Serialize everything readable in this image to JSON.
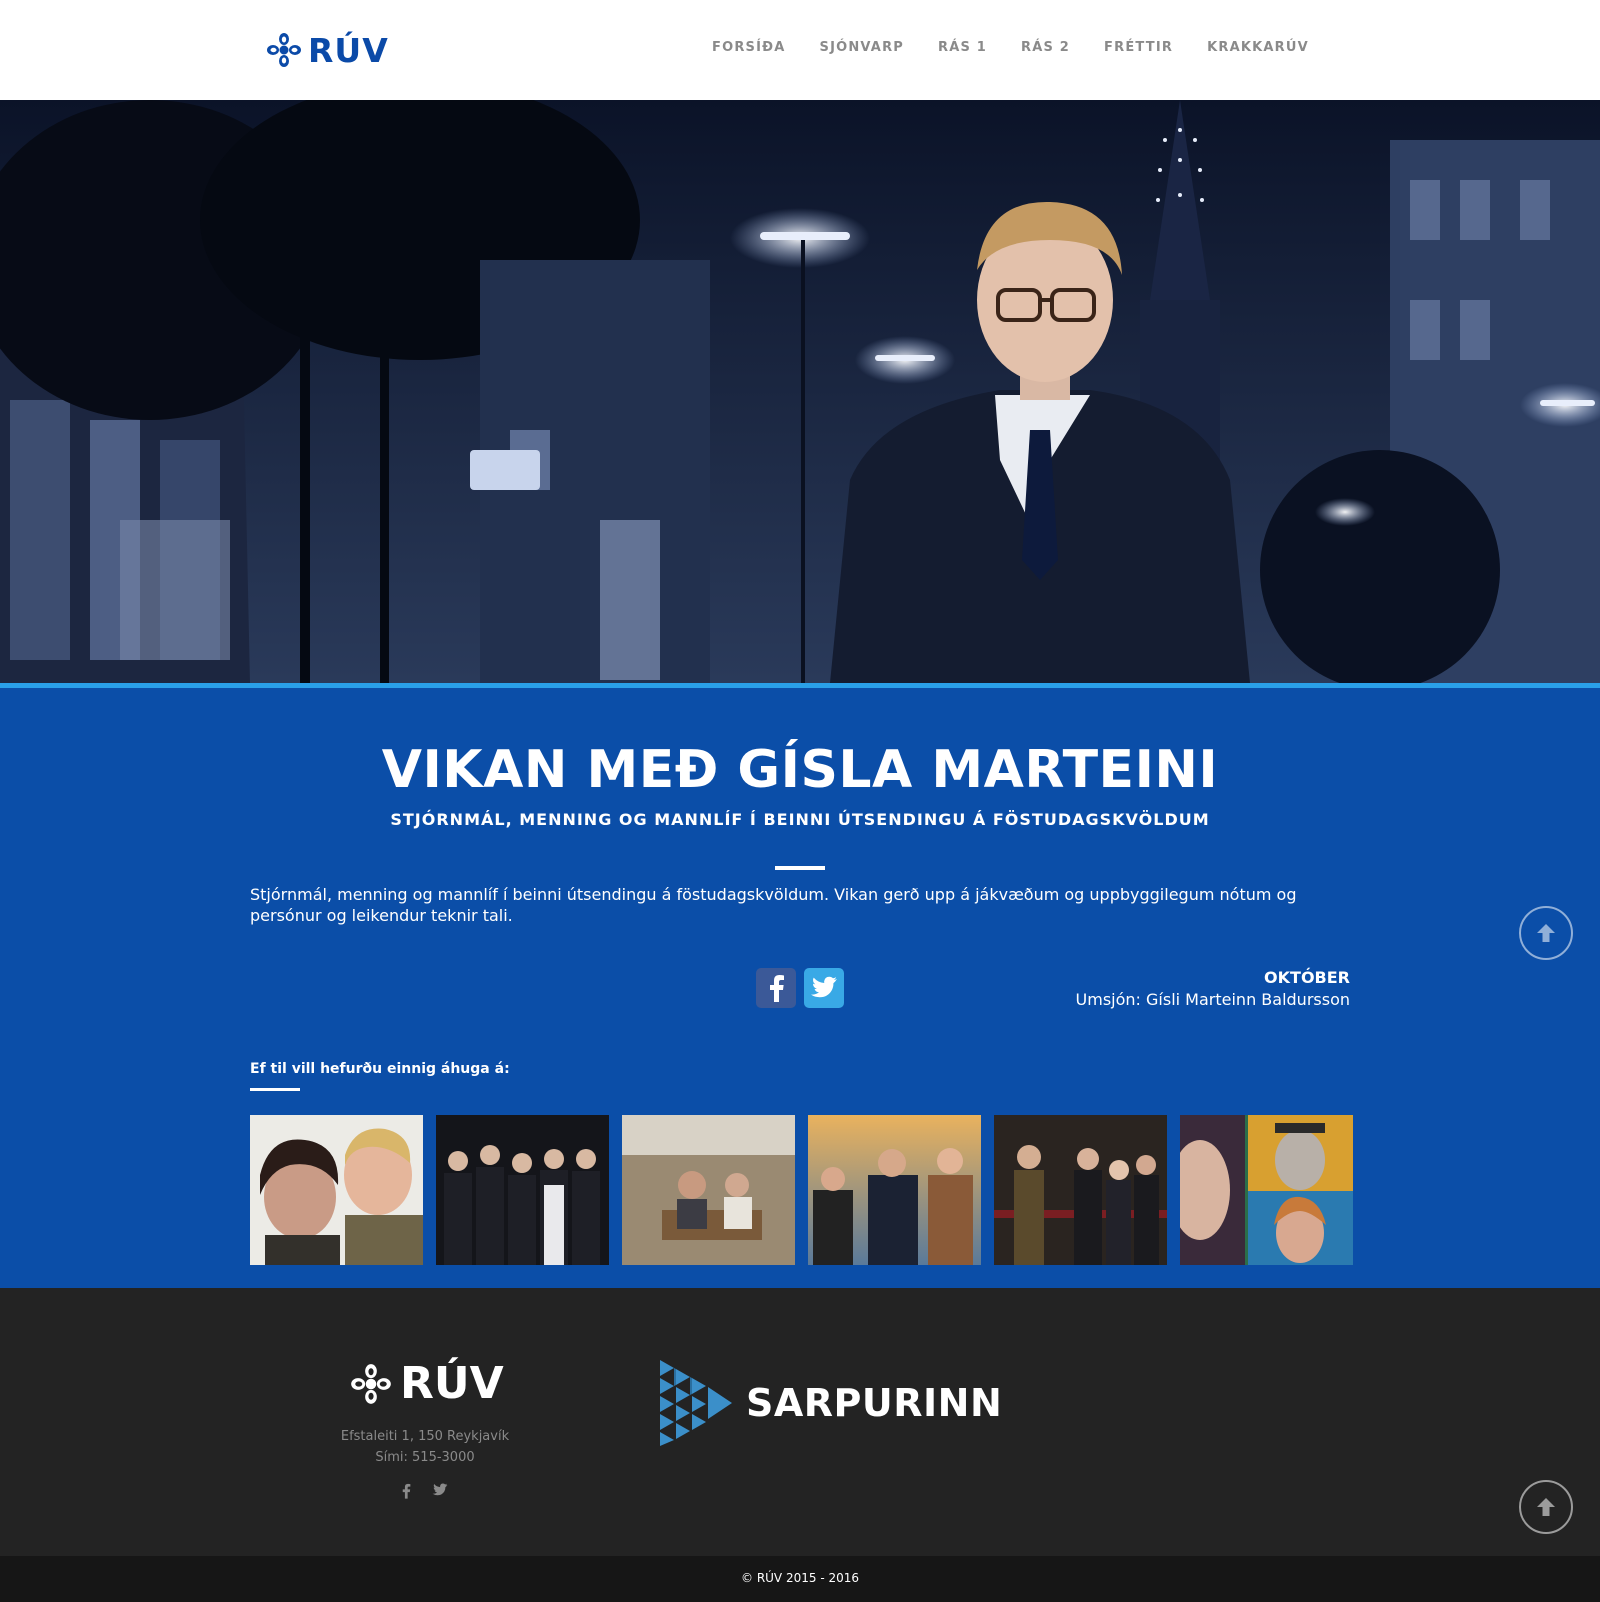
{
  "header": {
    "logo_text": "RÚV",
    "nav": [
      "FORSÍÐA",
      "SJÓNVARP",
      "RÁS 1",
      "RÁS 2",
      "FRÉTTIR",
      "KRAKKARÚV"
    ]
  },
  "show": {
    "title": "VIKAN MEÐ GÍSLA MARTEINI",
    "subtitle": "STJÓRNMÁL, MENNING OG MANNLÍF Í BEINNI ÚTSENDINGU Á FÖSTUDAGSKVÖLDUM",
    "description": "Stjórnmál, menning og mannlíf í beinni útsendingu á föstudagskvöldum. Vikan gerð upp á jákvæðum og uppbyggilegum nótum og persónur og leikendur teknir tali.",
    "month": "OKTÓBER",
    "host": "Umsjón: Gísli Marteinn Baldursson"
  },
  "related": {
    "label": "Ef til vill hefurðu einnig áhuga á:"
  },
  "footer": {
    "logo_text": "RÚV",
    "address": "Efstaleiti 1, 150 Reykjavík",
    "phone": "Sími: 515-3000",
    "sarpurinn": "SARPURINN",
    "copyright": "© RÚV 2015 - 2016"
  },
  "colors": {
    "brand_blue": "#0b4ea8",
    "accent_line": "#2aa0e8",
    "footer_bg": "#232323"
  }
}
